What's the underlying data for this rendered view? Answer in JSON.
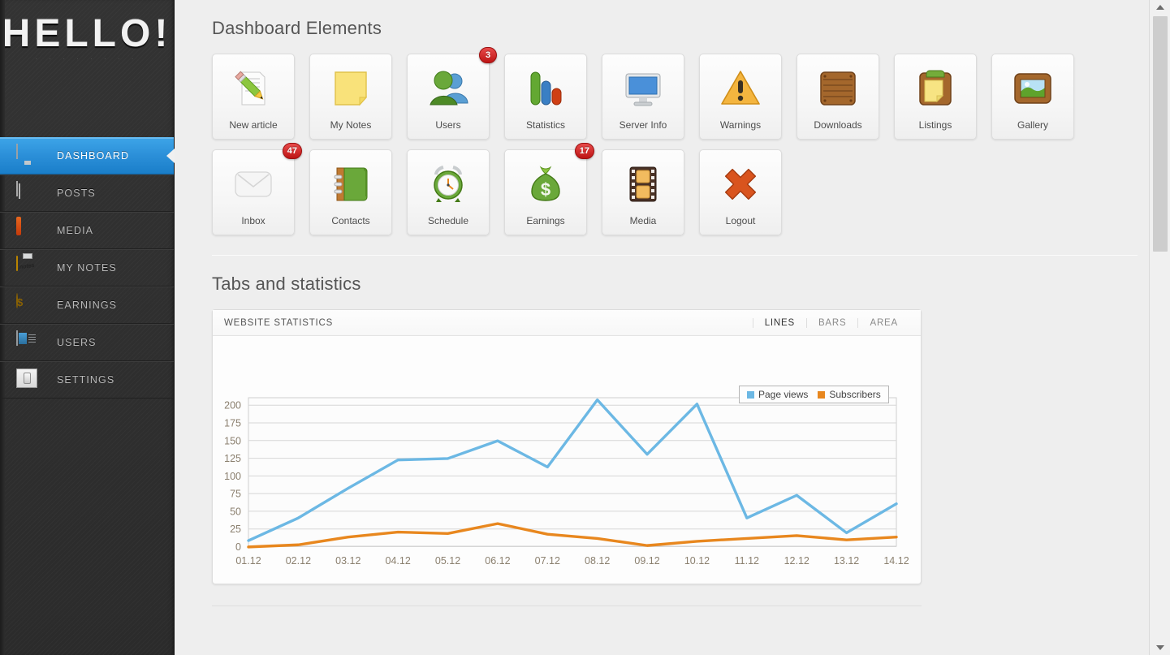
{
  "sidebar": {
    "logo": "HELLO!",
    "logo_sub": "· · · · · · · ·",
    "items": [
      {
        "label": "DASHBOARD",
        "icon": "monitor-icon",
        "active": true
      },
      {
        "label": "POSTS",
        "icon": "documents-icon",
        "active": false
      },
      {
        "label": "MEDIA",
        "icon": "picture-frame-icon",
        "active": false
      },
      {
        "label": "MY NOTES",
        "icon": "notepad-icon",
        "active": false
      },
      {
        "label": "EARNINGS",
        "icon": "coin-icon",
        "active": false
      },
      {
        "label": "USERS",
        "icon": "user-card-icon",
        "active": false
      },
      {
        "label": "SETTINGS",
        "icon": "switch-panel-icon",
        "active": false
      }
    ]
  },
  "main": {
    "elements_title": "Dashboard Elements",
    "tiles": [
      {
        "label": "New article",
        "icon": "pencil-document-icon",
        "badge": ""
      },
      {
        "label": "My Notes",
        "icon": "yellow-note-icon",
        "badge": ""
      },
      {
        "label": "Users",
        "icon": "two-people-icon",
        "badge": "3"
      },
      {
        "label": "Statistics",
        "icon": "bar-chart-icon",
        "badge": ""
      },
      {
        "label": "Server Info",
        "icon": "monitor-icon",
        "badge": ""
      },
      {
        "label": "Warnings",
        "icon": "warning-triangle-icon",
        "badge": ""
      },
      {
        "label": "Downloads",
        "icon": "wooden-crate-icon",
        "badge": ""
      },
      {
        "label": "Listings",
        "icon": "clipboard-icon",
        "badge": ""
      },
      {
        "label": "Gallery",
        "icon": "landscape-frame-icon",
        "badge": ""
      },
      {
        "label": "Inbox",
        "icon": "envelope-icon",
        "badge": "47"
      },
      {
        "label": "Contacts",
        "icon": "address-book-icon",
        "badge": ""
      },
      {
        "label": "Schedule",
        "icon": "alarm-clock-icon",
        "badge": ""
      },
      {
        "label": "Earnings",
        "icon": "money-bag-icon",
        "badge": "17"
      },
      {
        "label": "Media",
        "icon": "film-strip-icon",
        "badge": ""
      },
      {
        "label": "Logout",
        "icon": "red-x-icon",
        "badge": ""
      }
    ],
    "stats_title": "Tabs and statistics"
  },
  "panel": {
    "title": "WEBSITE STATISTICS",
    "tabs": [
      {
        "label": "LINES",
        "active": true
      },
      {
        "label": "BARS",
        "active": false
      },
      {
        "label": "AREA",
        "active": false
      }
    ]
  },
  "colors": {
    "page_views": "#6cb8e4",
    "subscribers": "#e8871e",
    "accent": "#2b8fd8",
    "badge": "#bd1414",
    "grid": "#d6d6d6",
    "axis_text": "#8a7f6e"
  },
  "chart_data": {
    "type": "line",
    "title": "WEBSITE STATISTICS",
    "xlabel": "",
    "ylabel": "",
    "ylim": [
      0,
      210
    ],
    "yticks": [
      0,
      25,
      50,
      75,
      100,
      125,
      150,
      175,
      200
    ],
    "grid": true,
    "legend_position": "top-right",
    "legend": [
      "Page views",
      "Subscribers"
    ],
    "categories": [
      "01.12",
      "02.12",
      "03.12",
      "04.12",
      "05.12",
      "06.12",
      "07.12",
      "08.12",
      "09.12",
      "10.12",
      "11.12",
      "12.12",
      "13.12",
      "14.12"
    ],
    "series": [
      {
        "name": "Page views",
        "color": "#6cb8e4",
        "values": [
          8,
          40,
          82,
          122,
          124,
          149,
          112,
          207,
          130,
          201,
          40,
          72,
          19,
          60
        ]
      },
      {
        "name": "Subscribers",
        "color": "#e8871e",
        "values": [
          -1,
          2,
          13,
          20,
          18,
          32,
          17,
          11,
          1,
          7,
          11,
          15,
          9,
          13
        ]
      }
    ]
  },
  "scrollbar": {
    "up_arrow": "chevron-up-icon",
    "down_arrow": "chevron-down-icon"
  }
}
